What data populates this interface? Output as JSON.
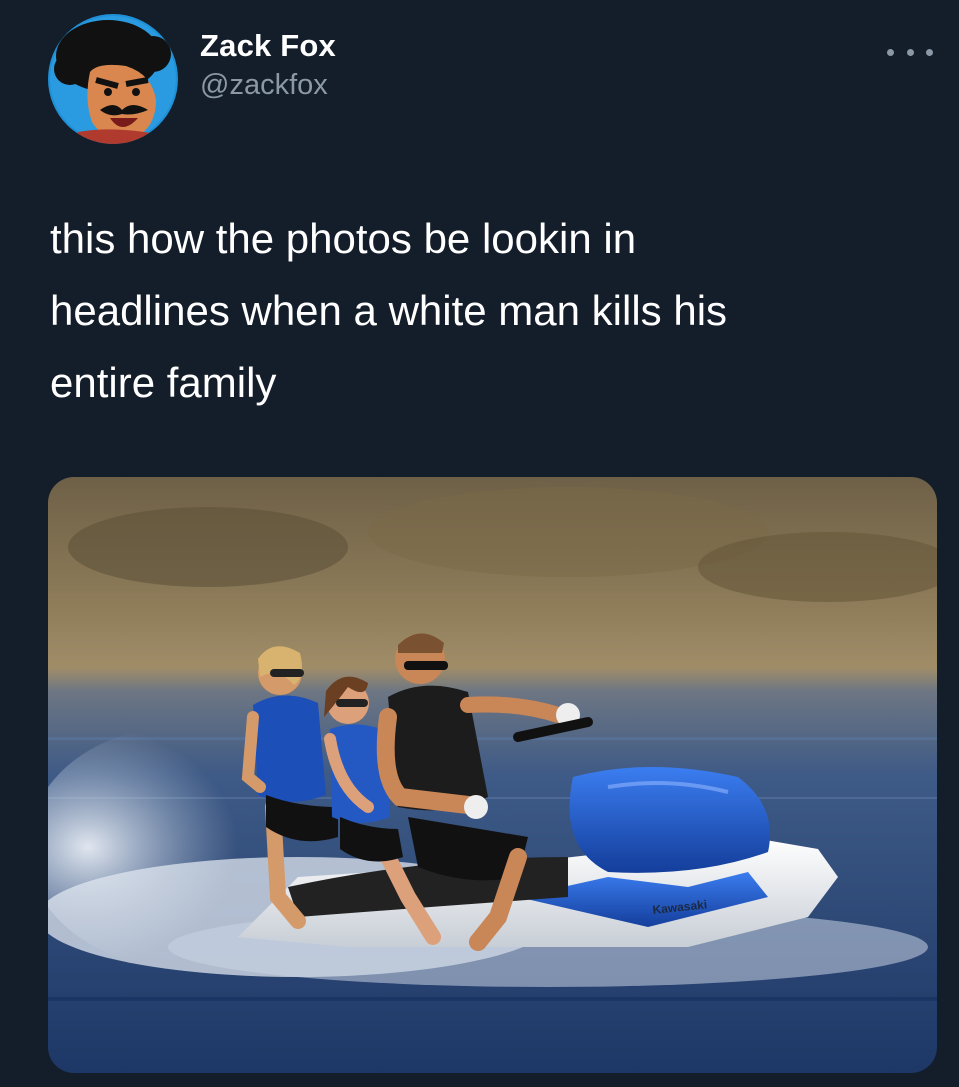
{
  "user": {
    "display_name": "Zack Fox",
    "handle": "@zackfox",
    "avatar_icon": "cartoon-avatar-icon"
  },
  "menu": {
    "icon": "more-options-icon"
  },
  "tweet": {
    "text": "this how the photos be lookin in\nheadlines when a white man kills his\nentire family"
  },
  "media": {
    "watercraft_brand_text": "Kawasaki"
  },
  "colors": {
    "background": "#141d2a",
    "text_primary": "#ffffff",
    "text_secondary": "#8b98a5",
    "jetski_blue": "#1e5bd6"
  }
}
